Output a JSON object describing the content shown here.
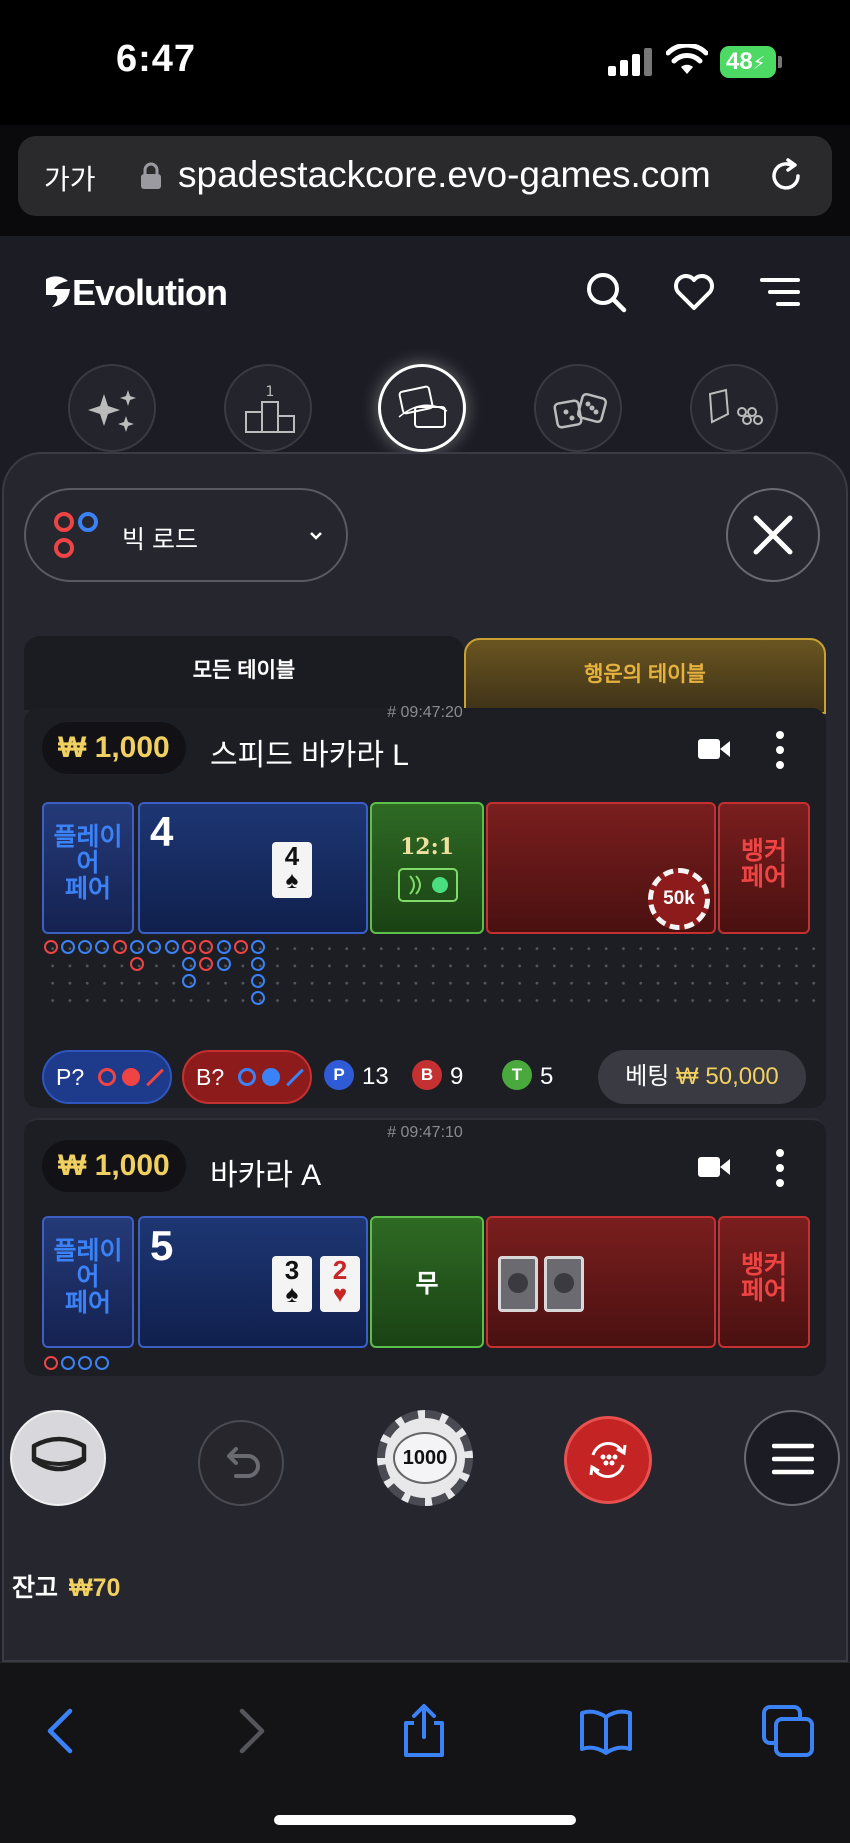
{
  "status_bar": {
    "time": "6:47",
    "battery": "48"
  },
  "browser": {
    "text_size": "가가",
    "url": "spadestackcore.evo-games.com"
  },
  "app": {
    "brand": "Evolution"
  },
  "filter": {
    "road_label": "빅 로드"
  },
  "tabs": {
    "all": "모든 테이블",
    "lucky": "행운의 테이블"
  },
  "tables": [
    {
      "id": "# 09:47:20",
      "limit": "₩ 1,000",
      "name": "스피드 바카라 L",
      "player_pair": "플레이어\n페어",
      "player_score": "4",
      "player_cards": [
        {
          "rank": "4",
          "suit": "♠"
        }
      ],
      "tie_label": "12:1",
      "banker_chip": "50k",
      "banker_pair": "뱅커\n페어",
      "predict_p": "P?",
      "predict_b": "B?",
      "counts": {
        "p_label": "P",
        "p": "13",
        "b_label": "B",
        "b": "9",
        "t_label": "T",
        "t": "5"
      },
      "bet_label": "베팅",
      "bet_amount": "₩ 50,000"
    },
    {
      "id": "# 09:47:10",
      "limit": "₩ 1,000",
      "name": "바카라 A",
      "player_pair": "플레이어\n페어",
      "player_score": "5",
      "player_cards": [
        {
          "rank": "3",
          "suit": "♠"
        },
        {
          "rank": "2",
          "suit": "♥"
        }
      ],
      "tie_label": "무",
      "banker_pair": "뱅커\n페어"
    }
  ],
  "controls": {
    "chip_value": "1000"
  },
  "balance": {
    "label": "잔고",
    "amount": "₩70"
  },
  "colors": {
    "player": "#3b82f6",
    "banker": "#ef4444",
    "tie": "#5bc04a",
    "gold": "#f0d060",
    "lucky_gold": "#e5b23e"
  }
}
